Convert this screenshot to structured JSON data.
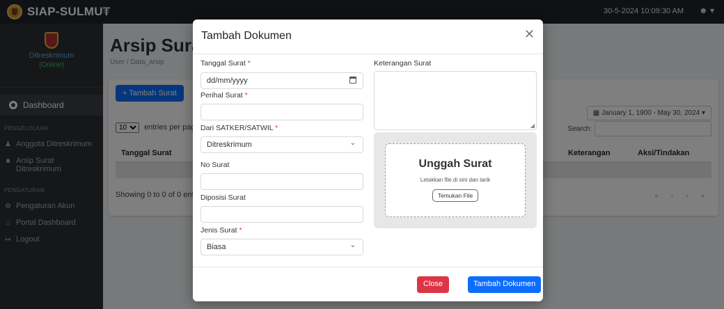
{
  "app": {
    "brand": "SIAP-SULMUT",
    "menu_icon": "≡",
    "datetime": "30-5-2024 10:09:30 AM",
    "user_icon": "user-icon"
  },
  "sidebar": {
    "profile_name": "Ditreskrimum",
    "profile_status": "(Online)",
    "dashboard": "Dashboard",
    "section_pengelolaan": "PENGELOLAAN",
    "items_pengelolaan": [
      {
        "label": "Anggota Ditreskrimum",
        "icon": "users-icon"
      },
      {
        "label": "Arsip Surat Ditreskrimum",
        "icon": "archive-icon"
      }
    ],
    "section_pengaturan": "PENGATURAN",
    "items_pengaturan": [
      {
        "label": "Pengaturan Akun",
        "icon": "gear-icon"
      },
      {
        "label": "Portal Dashboard",
        "icon": "home-icon"
      },
      {
        "label": "Logout",
        "icon": "logout-icon"
      }
    ]
  },
  "page": {
    "title": "Arsip Surat",
    "breadcrumb": "User / Data_arsip",
    "add_button": "+ Tambah Surat",
    "date_range": "January 1, 1900 - May 30, 2024",
    "entries_value": "10",
    "entries_suffix": "entries per page",
    "search_label": "Search:",
    "columns": [
      "Tanggal Surat",
      "Keterangan",
      "Aksi/Tindakan"
    ],
    "info": "Showing 0 to 0 of 0 entries"
  },
  "modal": {
    "title": "Tambah Dokumen",
    "tanggal_label": "Tanggal Surat",
    "tanggal_placeholder": "dd/mm/yyyy",
    "perihal_label": "Perihal Surat",
    "perihal_value": "",
    "dari_label": "Dari SATKER/SATWIL",
    "dari_value": "Ditreskrimum",
    "no_label": "No Surat",
    "no_value": "",
    "diposisi_label": "Diposisi Surat",
    "diposisi_value": "",
    "jenis_label": "Jenis Surat",
    "jenis_value": "Biasa",
    "keterangan_label": "Keterangan Surat",
    "required_mark": "*",
    "upload_title": "Unggah Surat",
    "upload_hint": "Letakkan file di sini dan tarik",
    "upload_button": "Temukan File",
    "close_button": "Close",
    "submit_button": "Tambah Dokumen"
  },
  "colors": {
    "primary": "#0d6efd",
    "danger": "#dc3545",
    "topbar": "#1f2328",
    "sidebar": "#2b2f33"
  }
}
